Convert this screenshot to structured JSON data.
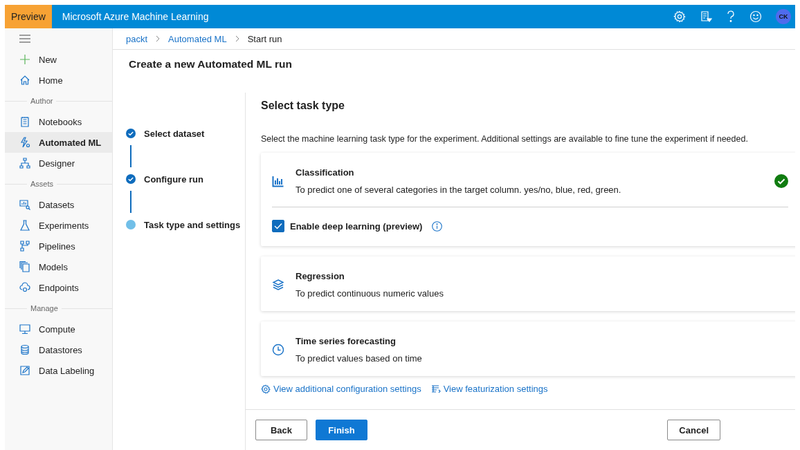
{
  "header": {
    "badge": "Preview",
    "title": "Microsoft Azure Machine Learning",
    "avatar": "CK"
  },
  "sidebar": {
    "groups": [
      {
        "items": [
          {
            "label": "New",
            "selected": false
          },
          {
            "label": "Home",
            "selected": false
          }
        ]
      },
      {
        "heading": "Author",
        "items": [
          {
            "label": "Notebooks",
            "selected": false
          },
          {
            "label": "Automated ML",
            "selected": true
          },
          {
            "label": "Designer",
            "selected": false
          }
        ]
      },
      {
        "heading": "Assets",
        "items": [
          {
            "label": "Datasets",
            "selected": false
          },
          {
            "label": "Experiments",
            "selected": false
          },
          {
            "label": "Pipelines",
            "selected": false
          },
          {
            "label": "Models",
            "selected": false
          },
          {
            "label": "Endpoints",
            "selected": false
          }
        ]
      },
      {
        "heading": "Manage",
        "items": [
          {
            "label": "Compute",
            "selected": false
          },
          {
            "label": "Datastores",
            "selected": false
          },
          {
            "label": "Data Labeling",
            "selected": false
          }
        ]
      }
    ]
  },
  "breadcrumb": [
    {
      "label": "packt",
      "kind": "link"
    },
    {
      "label": "Automated ML",
      "kind": "link"
    },
    {
      "label": "Start run",
      "kind": "current"
    }
  ],
  "page_title": "Create a new Automated ML run",
  "steps": [
    {
      "label": "Select dataset",
      "completed": true
    },
    {
      "label": "Configure run",
      "completed": true
    },
    {
      "label": "Task type and settings",
      "completed": false
    }
  ],
  "section_title": "Select task type",
  "description": "Select the machine learning task type for the experiment. Additional settings are available to fine tune the experiment if needed.",
  "task_types": [
    {
      "title": "Classification",
      "description": "To predict one of several categories in the target column. yes/no, blue, red, green.",
      "selected": true,
      "option": {
        "label": "Enable deep learning (preview)",
        "checked": true
      }
    },
    {
      "title": "Regression",
      "description": "To predict continuous numeric values",
      "selected": false
    },
    {
      "title": "Time series forecasting",
      "description": "To predict values based on time",
      "selected": false
    }
  ],
  "links": [
    "View additional configuration settings",
    "View featurization settings"
  ],
  "buttons": [
    {
      "label": "Back",
      "kind": "default"
    },
    {
      "label": "Finish",
      "kind": "primary"
    },
    {
      "label": "Cancel",
      "kind": "default"
    }
  ]
}
